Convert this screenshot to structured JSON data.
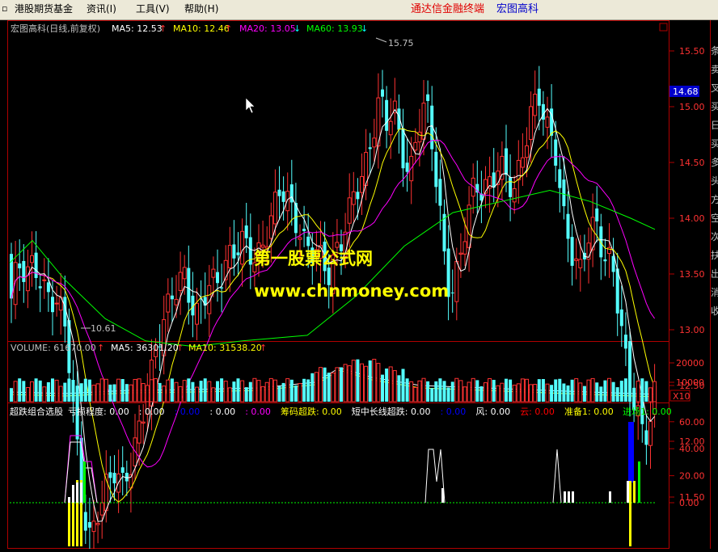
{
  "menu": {
    "items": [
      {
        "label": "港股期货基金"
      },
      {
        "label": "资讯(I)"
      },
      {
        "label": "工具(V)"
      },
      {
        "label": "帮助(H)"
      }
    ],
    "brand": "通达信金融终端",
    "stock_name": "宏图高科"
  },
  "price_panel": {
    "header": {
      "title": "宏图高科(日线,前复权)",
      "ma5": "MA5: 12.53",
      "ma10": "MA10: 12.46",
      "ma20": "MA20: 13.05",
      "ma60": "MA60: 13.93"
    },
    "high_label": "15.75",
    "low_label": "10.61",
    "current_price": "14.68",
    "watermark_title": "第一股票公式网",
    "watermark_url": "www.chnmoney.com",
    "y_ticks": [
      "15.50",
      "15.00",
      "14.50",
      "14.00",
      "13.50",
      "13.00",
      "12.50",
      "12.00",
      "11.50",
      "11.00"
    ]
  },
  "volume_panel": {
    "header": {
      "volume": "VOLUME: 61670.00",
      "ma5": "MA5: 36301.20",
      "ma10": "MA10: 31538.20"
    },
    "y_ticks": [
      "20000",
      "10000"
    ],
    "multiplier": "X10"
  },
  "indicator_panel": {
    "header": [
      {
        "label": "超跌组合选股",
        "color": "#ffffff"
      },
      {
        "label": "亏损程度: 0.00",
        "color": "#ffffff"
      },
      {
        "label": ": 0.00",
        "color": "#ffffff"
      },
      {
        "label": ": 0.00",
        "color": "#0000ff"
      },
      {
        "label": ": 0.00",
        "color": "#ffffff"
      },
      {
        "label": ": 0.00",
        "color": "#ff00ff"
      },
      {
        "label": "筹码超跌: 0.00",
        "color": "#ffff00"
      },
      {
        "label": "短中长线超跌: 0.00",
        "color": "#ffffff"
      },
      {
        "label": ": 0.00",
        "color": "#0000ff"
      },
      {
        "label": "风: 0.00",
        "color": "#ffffff"
      },
      {
        "label": "云: 0.00",
        "color": "#ff0000"
      },
      {
        "label": "准备1: 0.00",
        "color": "#ffff00"
      },
      {
        "label": "进场1: 0.00",
        "color": "#00ff00"
      }
    ],
    "y_ticks": [
      "60.00",
      "40.00",
      "20.00",
      "0.00"
    ]
  },
  "colors": {
    "up": "#ff3232",
    "down": "#54ffff",
    "ma5": "#ffffff",
    "ma10": "#ffff00",
    "ma20": "#ff00ff",
    "ma60": "#00ff00",
    "frame": "#b00000",
    "axis_text": "#ff3232"
  }
}
